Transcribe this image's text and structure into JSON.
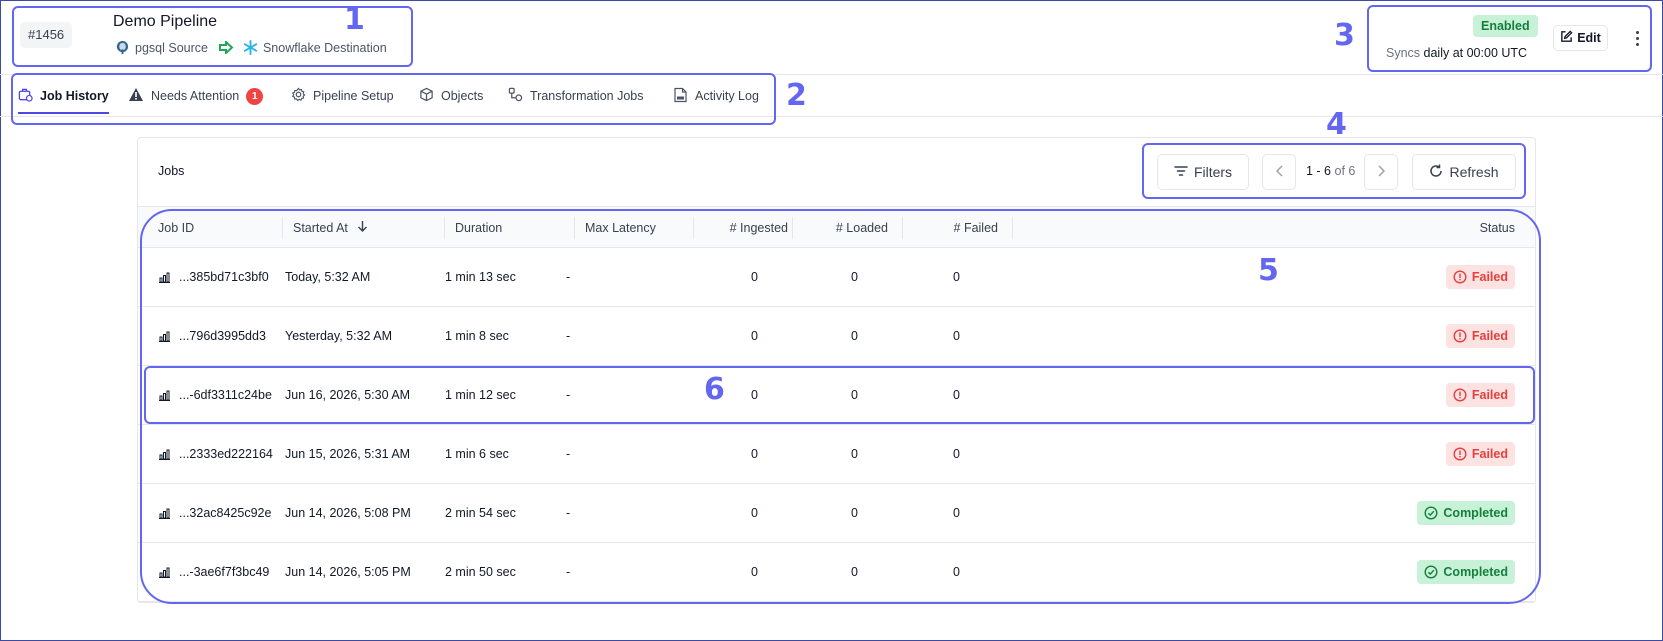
{
  "pipeline": {
    "id_label": "#1456",
    "name": "Demo Pipeline",
    "source_label": "pgsql Source",
    "destination_label": "Snowflake Destination",
    "status_label": "Enabled",
    "sync_prefix": "Syncs",
    "sync_schedule": "daily at 00:00 UTC",
    "edit_label": "Edit"
  },
  "tabs": [
    {
      "label": "Job History",
      "icon": "briefcase-icon",
      "active": true
    },
    {
      "label": "Needs Attention",
      "icon": "warning-icon",
      "badge": "1"
    },
    {
      "label": "Pipeline Setup",
      "icon": "gear-icon"
    },
    {
      "label": "Objects",
      "icon": "cube-icon"
    },
    {
      "label": "Transformation Jobs",
      "icon": "transform-icon"
    },
    {
      "label": "Activity Log",
      "icon": "log-file-icon"
    }
  ],
  "jobs_panel": {
    "title": "Jobs",
    "filters_label": "Filters",
    "pagination": {
      "range": "1 - 6",
      "of_label": "of 6"
    },
    "refresh_label": "Refresh"
  },
  "table": {
    "columns": [
      "Job ID",
      "Started At",
      "Duration",
      "Max Latency",
      "# Ingested",
      "# Loaded",
      "# Failed",
      "Status"
    ],
    "rows": [
      {
        "job_id": "...385bd71c3bf0",
        "started_at": "Today, 5:32 AM",
        "duration": "1 min 13 sec",
        "max_latency": "-",
        "ingested": "0",
        "loaded": "0",
        "failed": "0",
        "status": "Failed"
      },
      {
        "job_id": "...796d3995dd3",
        "started_at": "Yesterday, 5:32 AM",
        "duration": "1 min 8 sec",
        "max_latency": "-",
        "ingested": "0",
        "loaded": "0",
        "failed": "0",
        "status": "Failed"
      },
      {
        "job_id": "...-6df3311c24be",
        "started_at": "Jun 16, 2026, 5:30 AM",
        "duration": "1 min 12 sec",
        "max_latency": "-",
        "ingested": "0",
        "loaded": "0",
        "failed": "0",
        "status": "Failed"
      },
      {
        "job_id": "...2333ed222164",
        "started_at": "Jun 15, 2026, 5:31 AM",
        "duration": "1 min 6 sec",
        "max_latency": "-",
        "ingested": "0",
        "loaded": "0",
        "failed": "0",
        "status": "Failed"
      },
      {
        "job_id": "...32ac8425c92e",
        "started_at": "Jun 14, 2026, 5:08 PM",
        "duration": "2 min 54 sec",
        "max_latency": "-",
        "ingested": "0",
        "loaded": "0",
        "failed": "0",
        "status": "Completed"
      },
      {
        "job_id": "...-3ae6f7f3bc49",
        "started_at": "Jun 14, 2026, 5:05 PM",
        "duration": "2 min 50 sec",
        "max_latency": "-",
        "ingested": "0",
        "loaded": "0",
        "failed": "0",
        "status": "Completed"
      }
    ]
  },
  "annotations": [
    "1",
    "2",
    "3",
    "4",
    "5",
    "6"
  ],
  "colors": {
    "accent": "#6366f1",
    "tab_underline": "#4f46e5",
    "failed": "#e53e3e",
    "failed_bg": "#fde2e2",
    "completed": "#15803d",
    "completed_bg": "#c8f2d7"
  }
}
